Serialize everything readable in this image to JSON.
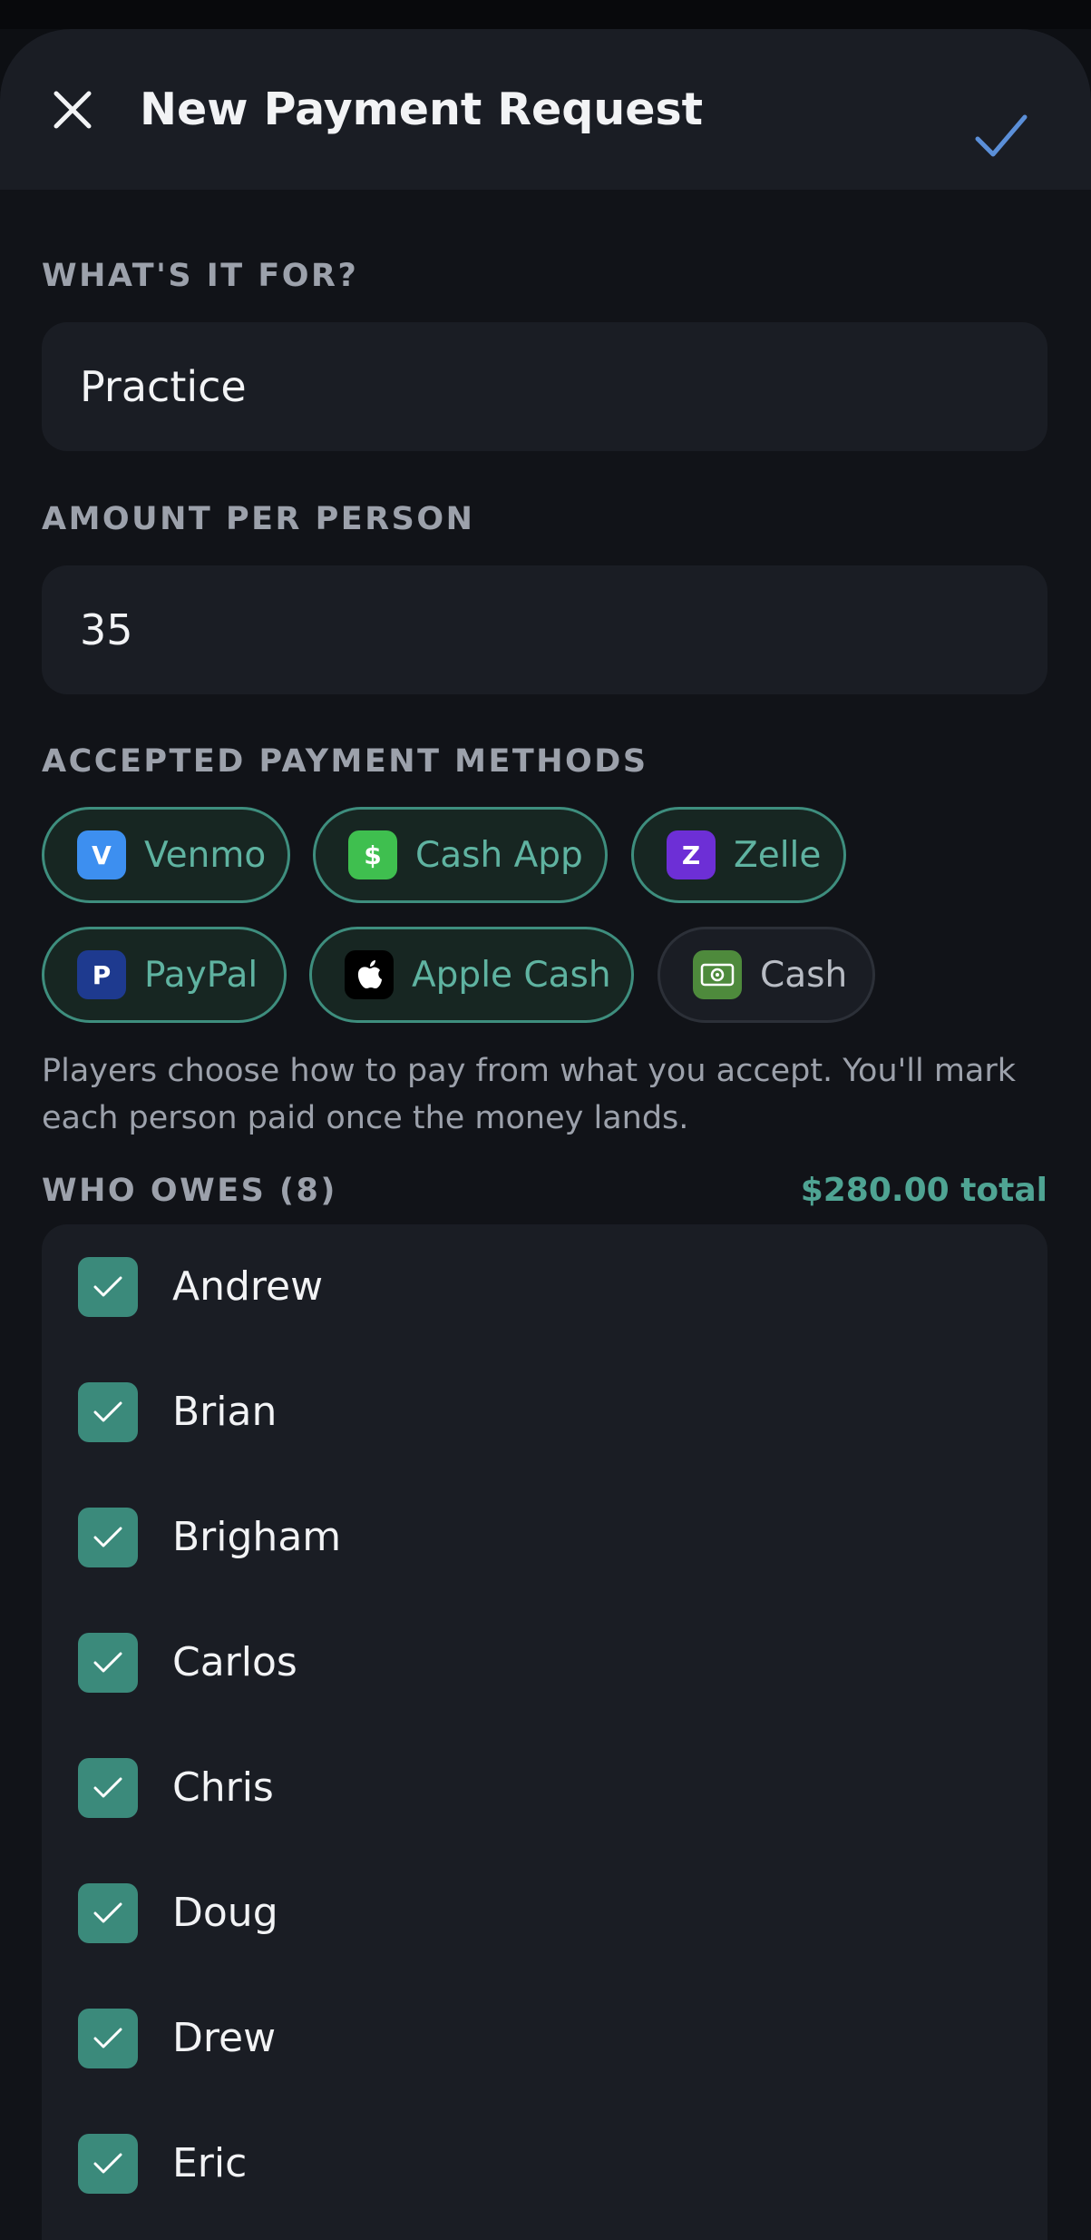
{
  "header": {
    "title": "New Payment Request"
  },
  "form": {
    "purpose_label": "WHAT'S IT FOR?",
    "purpose_value": "Practice",
    "amount_label": "AMOUNT PER PERSON",
    "amount_value": "35"
  },
  "payment_methods": {
    "label": "ACCEPTED PAYMENT METHODS",
    "items": [
      {
        "label": "Venmo",
        "icon_text": "V",
        "icon": "venmo-icon",
        "color": "#3d8ff0",
        "selected": true
      },
      {
        "label": "Cash App",
        "icon_text": "$",
        "icon": "cash-app-icon",
        "color": "#3fbf4f",
        "selected": true
      },
      {
        "label": "Zelle",
        "icon_text": "Z",
        "icon": "zelle-icon",
        "color": "#6d2fd6",
        "selected": true
      },
      {
        "label": "PayPal",
        "icon_text": "P",
        "icon": "paypal-icon",
        "color": "#1e3a8f",
        "selected": true
      },
      {
        "label": "Apple Cash",
        "icon_text": "",
        "icon": "apple-icon",
        "color": "#000000",
        "selected": true
      },
      {
        "label": "Cash",
        "icon_text": "",
        "icon": "banknote-icon",
        "color": "#4e8a3c",
        "selected": false
      }
    ],
    "hint": "Players choose how to pay from what you accept. You'll mark each person paid once the money lands."
  },
  "who_owes": {
    "label": "WHO OWES (8)",
    "total": "$280.00 total",
    "people": [
      {
        "name": "Andrew",
        "checked": true
      },
      {
        "name": "Brian",
        "checked": true
      },
      {
        "name": "Brigham",
        "checked": true
      },
      {
        "name": "Carlos",
        "checked": true
      },
      {
        "name": "Chris",
        "checked": true
      },
      {
        "name": "Doug",
        "checked": true
      },
      {
        "name": "Drew",
        "checked": true
      },
      {
        "name": "Eric",
        "checked": true
      }
    ]
  },
  "colors": {
    "accent": "#3b8a7b",
    "confirm": "#5b8fd8",
    "background": "#111318"
  }
}
